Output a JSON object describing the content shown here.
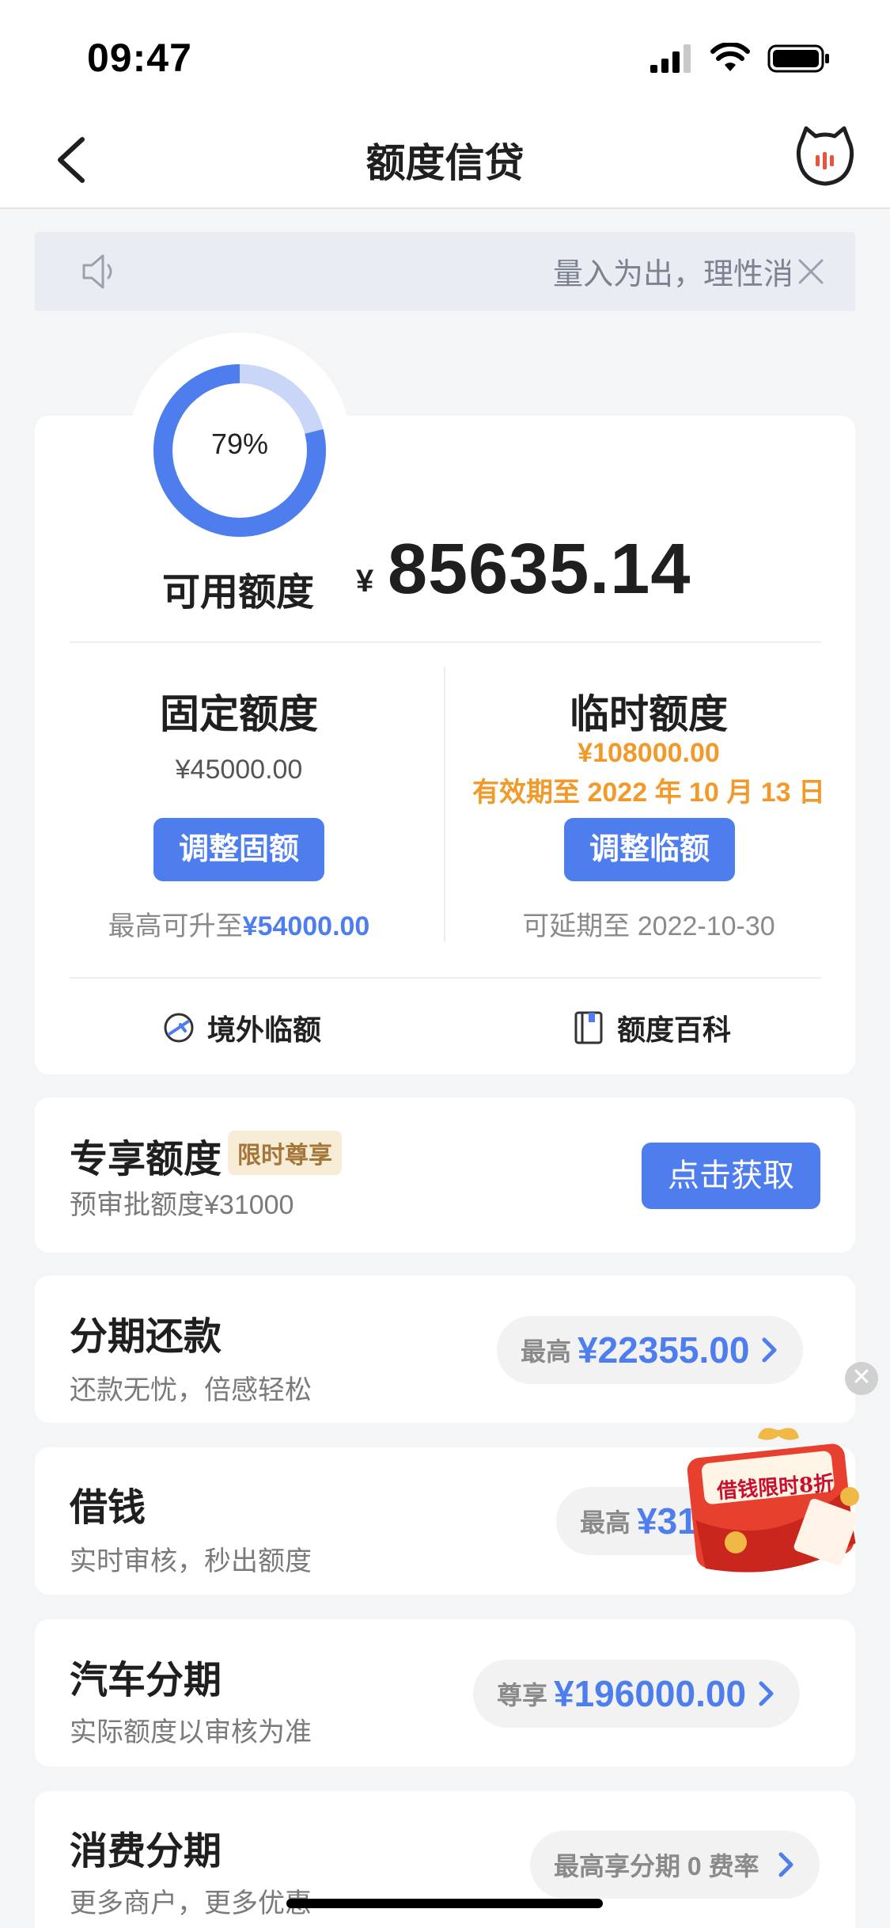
{
  "status_bar": {
    "time": "09:47"
  },
  "nav": {
    "title": "额度信贷"
  },
  "notice": {
    "text": "量入为出，理性消费"
  },
  "credit": {
    "ring_percent_label": "79%",
    "ring_fraction": 0.79,
    "available_label": "可用额度",
    "currency": "¥",
    "available_amount": "85635.14",
    "fixed": {
      "title": "固定额度",
      "amount": "¥45000.00",
      "button": "调整固额",
      "note_prefix": "最高可升至",
      "note_value": "¥54000.00"
    },
    "temporary": {
      "title": "临时额度",
      "amount": "¥108000.00",
      "validity": "有效期至 2022 年 10 月 13 日",
      "button": "调整临额",
      "note": "可延期至 2022-10-30"
    },
    "links": {
      "overseas": "境外临额",
      "wiki": "额度百科"
    }
  },
  "exclusive": {
    "title": "专享额度",
    "badge": "限时尊享",
    "subtitle": "预审批额度¥31000",
    "button": "点击获取"
  },
  "products": [
    {
      "title": "分期还款",
      "subtitle": "还款无忧，倍感轻松",
      "pill_prefix": "最高",
      "pill_value": "¥22355.00"
    },
    {
      "title": "借钱",
      "subtitle": "实时审核，秒出额度",
      "pill_prefix": "最高",
      "pill_value": "¥31"
    },
    {
      "title": "汽车分期",
      "subtitle": "实际额度以审核为准",
      "pill_prefix": "尊享",
      "pill_value": "¥196000.00"
    },
    {
      "title": "消费分期",
      "subtitle": "更多商户，更多优惠",
      "pill_prefix": "最高享分期 0 费率",
      "pill_value": ""
    }
  ],
  "promo": {
    "text": "借钱限时8折"
  },
  "colors": {
    "accent": "#4e7ded",
    "orange": "#f19a2a",
    "badge_bg": "#f7ecd5"
  }
}
